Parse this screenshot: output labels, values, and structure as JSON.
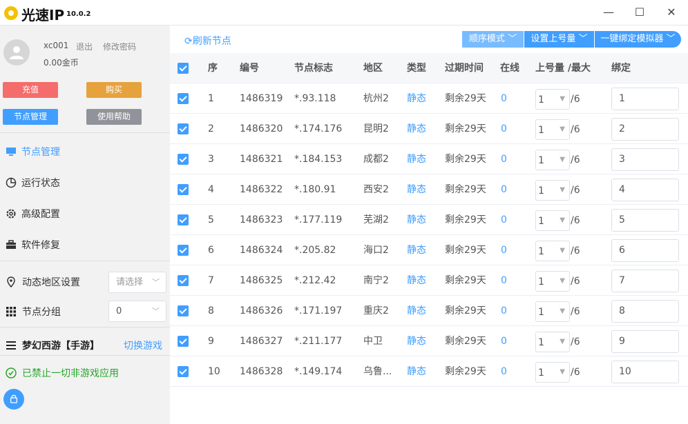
{
  "app": {
    "title": "光速IP",
    "version": "10.0.2",
    "window_buttons": {
      "minimize": "—",
      "maximize": "☐",
      "close": "✕"
    }
  },
  "user": {
    "name": "xc001",
    "logout": "退出",
    "change_password": "修改密码",
    "coins": "0.00金币"
  },
  "sidebar_buttons": {
    "recharge": "充值",
    "buy": "购买",
    "node_manage": "节点管理",
    "help": "使用帮助"
  },
  "nav": [
    {
      "label": "节点管理",
      "icon": "monitor-icon",
      "active": true
    },
    {
      "label": "运行状态",
      "icon": "pie-chart-icon",
      "active": false
    },
    {
      "label": "高级配置",
      "icon": "gear-icon",
      "active": false
    },
    {
      "label": "软件修复",
      "icon": "toolbox-icon",
      "active": false
    }
  ],
  "region": {
    "label": "动态地区设置",
    "placeholder": "请选择"
  },
  "group": {
    "label": "节点分组",
    "value": "0"
  },
  "game": {
    "name": "梦幻西游【手游】",
    "switch": "切换游戏"
  },
  "ban_notice": "已禁止一切非游戏应用",
  "toolbar": {
    "refresh": "刷新节点",
    "order_mode": "顺序模式",
    "set_max": "设置上号量",
    "bind_emulator": "一键绑定模拟器"
  },
  "table": {
    "headers": [
      "序",
      "编号",
      "节点标志",
      "地区",
      "类型",
      "过期时间",
      "在线",
      "上号量 /最大",
      "绑定"
    ],
    "rows": [
      {
        "seq": "1",
        "id": "1486319",
        "node": "*.93.118",
        "region": "杭州2",
        "type": "静态",
        "expire": "剩余29天",
        "online": "0",
        "count": "1",
        "max": "/6",
        "bind": "1"
      },
      {
        "seq": "2",
        "id": "1486320",
        "node": "*.174.176",
        "region": "昆明2",
        "type": "静态",
        "expire": "剩余29天",
        "online": "0",
        "count": "1",
        "max": "/6",
        "bind": "2"
      },
      {
        "seq": "3",
        "id": "1486321",
        "node": "*.184.153",
        "region": "成都2",
        "type": "静态",
        "expire": "剩余29天",
        "online": "0",
        "count": "1",
        "max": "/6",
        "bind": "3"
      },
      {
        "seq": "4",
        "id": "1486322",
        "node": "*.180.91",
        "region": "西安2",
        "type": "静态",
        "expire": "剩余29天",
        "online": "0",
        "count": "1",
        "max": "/6",
        "bind": "4"
      },
      {
        "seq": "5",
        "id": "1486323",
        "node": "*.177.119",
        "region": "芜湖2",
        "type": "静态",
        "expire": "剩余29天",
        "online": "0",
        "count": "1",
        "max": "/6",
        "bind": "5"
      },
      {
        "seq": "6",
        "id": "1486324",
        "node": "*.205.82",
        "region": "海口2",
        "type": "静态",
        "expire": "剩余29天",
        "online": "0",
        "count": "1",
        "max": "/6",
        "bind": "6"
      },
      {
        "seq": "7",
        "id": "1486325",
        "node": "*.212.42",
        "region": "南宁2",
        "type": "静态",
        "expire": "剩余29天",
        "online": "0",
        "count": "1",
        "max": "/6",
        "bind": "7"
      },
      {
        "seq": "8",
        "id": "1486326",
        "node": "*.171.197",
        "region": "重庆2",
        "type": "静态",
        "expire": "剩余29天",
        "online": "0",
        "count": "1",
        "max": "/6",
        "bind": "8"
      },
      {
        "seq": "9",
        "id": "1486327",
        "node": "*.211.177",
        "region": "中卫",
        "type": "静态",
        "expire": "剩余29天",
        "online": "0",
        "count": "1",
        "max": "/6",
        "bind": "9"
      },
      {
        "seq": "10",
        "id": "1486328",
        "node": "*.149.174",
        "region": "乌鲁...",
        "type": "静态",
        "expire": "剩余29天",
        "online": "0",
        "count": "1",
        "max": "/6",
        "bind": "10"
      }
    ]
  },
  "colors": {
    "accent": "#409eff",
    "recharge": "#f56c6c",
    "buy": "#e6a23c",
    "help": "#909399",
    "success": "#27a52b"
  }
}
